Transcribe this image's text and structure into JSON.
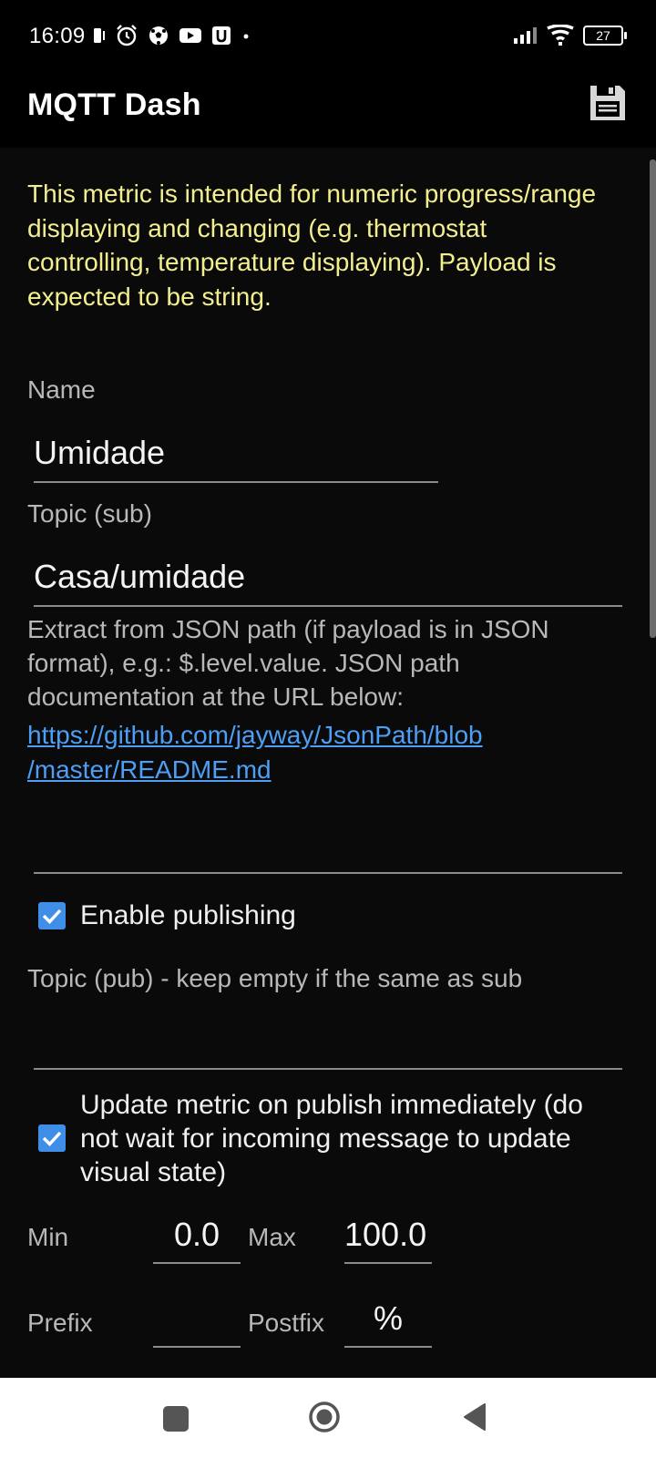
{
  "status_bar": {
    "time": "16:09",
    "battery": "27",
    "icons_left": [
      "sim-icon",
      "alarm-icon",
      "soccer-ball-icon",
      "youtube-icon",
      "u-app-icon",
      "dot-icon"
    ],
    "icons_right": [
      "signal-icon",
      "wifi-icon",
      "battery-icon"
    ]
  },
  "app_bar": {
    "title": "MQTT Dash",
    "save_icon": "save-icon"
  },
  "form": {
    "intro": "This metric is intended for numeric progress/range displaying and changing (e.g. thermostat controlling, temperature displaying). Payload is expected to be string.",
    "name_label": "Name",
    "name_value": "Umidade",
    "topic_sub_label": "Topic (sub)",
    "topic_sub_value": "Casa/umidade",
    "json_help": "Extract from JSON path (if payload is in JSON format), e.g.: $.level.value. JSON path documentation at the URL below:",
    "json_link_line1": "https://github.com/jayway/JsonPath/blob",
    "json_link_line2": "/master/README.md",
    "json_path_value": "",
    "enable_publishing_label": "Enable publishing",
    "enable_publishing_checked": true,
    "topic_pub_label": "Topic (pub) - keep empty if the same as sub",
    "topic_pub_value": "",
    "update_metric_label": "Update metric on publish immediately (do not wait for incoming message to update visual state)",
    "update_metric_checked": true,
    "min_label": "Min",
    "min_value": "0.0",
    "max_label": "Max",
    "max_value": "100.0",
    "prefix_label": "Prefix",
    "prefix_value": "",
    "postfix_label": "Postfix",
    "postfix_value": "%"
  },
  "nav_bar": {
    "recents": "recents-square-icon",
    "home": "home-circle-icon",
    "back": "back-triangle-icon"
  },
  "colors": {
    "background": "#0a0a0a",
    "intro_text": "#f3ef8f",
    "link": "#4d9ef5",
    "checkbox": "#3f8ee8"
  }
}
